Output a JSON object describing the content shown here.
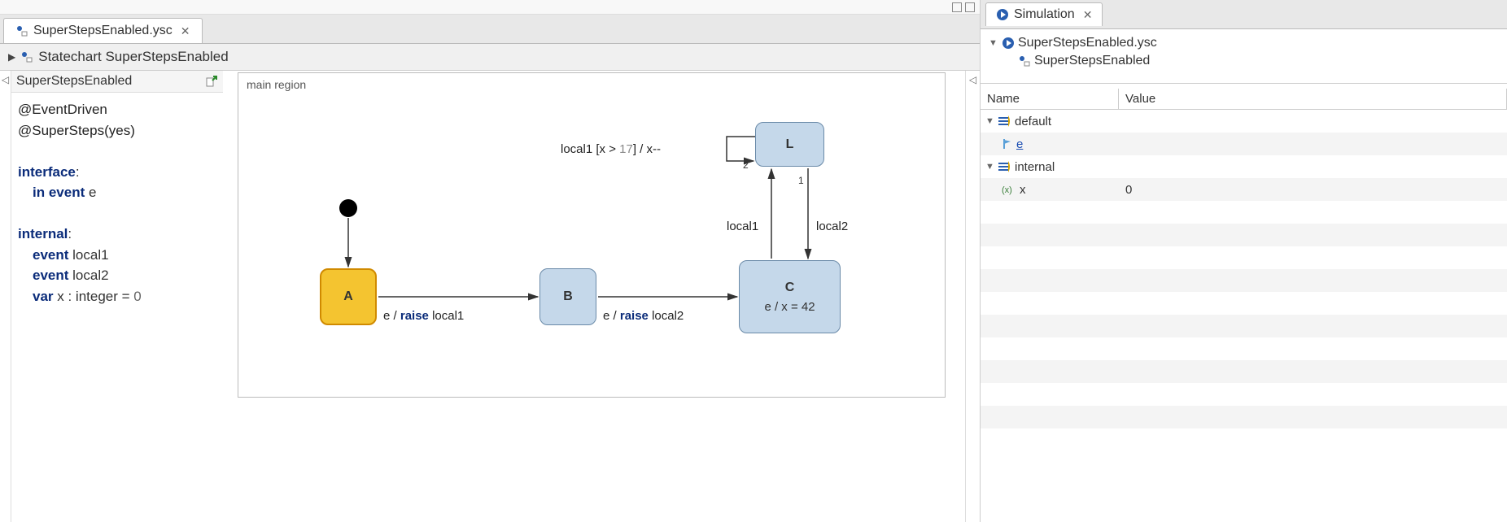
{
  "editor": {
    "tab_label": "SuperStepsEnabled.ysc",
    "breadcrumb": "Statechart SuperStepsEnabled",
    "def_header": "SuperStepsEnabled",
    "definitions": {
      "anno1": "@EventDriven",
      "anno2": "@SuperSteps(yes)",
      "interface_kw": "interface",
      "in_event_kw": "in event",
      "in_event_name": " e",
      "internal_kw": "internal",
      "event_kw1": "event",
      "event_name1": " local1",
      "event_kw2": "event",
      "event_name2": " local2",
      "var_kw": "var",
      "var_decl": " x : integer = ",
      "var_init": "0"
    },
    "diagram": {
      "region_label": "main region",
      "state_a": "A",
      "state_b": "B",
      "state_c_name": "C",
      "state_c_action": "e / x = 42",
      "state_l": "L",
      "t_a_b_pre": "e / ",
      "t_a_b_raise": "raise",
      "t_a_b_post": " local1",
      "t_b_c_pre": "e / ",
      "t_b_c_raise": "raise",
      "t_b_c_post": " local2",
      "t_c_l": "local1",
      "t_l_c": "local2",
      "t_l_self_pre": "local1 [x > ",
      "t_l_self_num": "17",
      "t_l_self_post": "] / x--",
      "prio_1": "1",
      "prio_2": "2"
    }
  },
  "sim": {
    "tab_label": "Simulation",
    "tree_root": "SuperStepsEnabled.ysc",
    "tree_child": "SuperStepsEnabled",
    "columns": {
      "name": "Name",
      "value": "Value"
    },
    "rows": {
      "default": "default",
      "event_e": "e",
      "internal": "internal",
      "var_x": "x",
      "x_value": "0"
    }
  }
}
